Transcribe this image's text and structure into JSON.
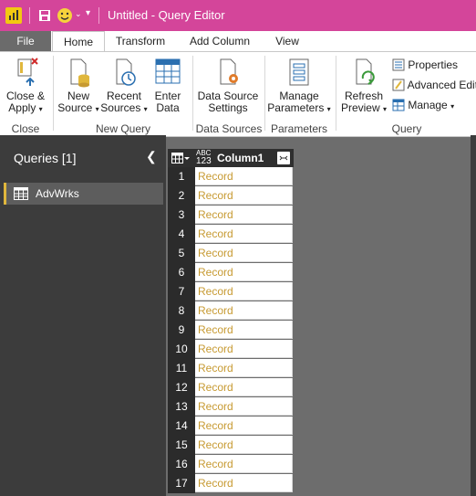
{
  "window": {
    "title": "Untitled - Query Editor"
  },
  "tabs": [
    {
      "label": "File"
    },
    {
      "label": "Home"
    },
    {
      "label": "Transform"
    },
    {
      "label": "Add Column"
    },
    {
      "label": "View"
    }
  ],
  "ribbon": {
    "close_apply": {
      "line1": "Close &",
      "line2": "Apply"
    },
    "new_source": {
      "line1": "New",
      "line2": "Source"
    },
    "recent_sources": {
      "line1": "Recent",
      "line2": "Sources"
    },
    "enter_data": {
      "line1": "Enter",
      "line2": "Data"
    },
    "data_source_settings": {
      "line1": "Data Source",
      "line2": "Settings"
    },
    "manage_parameters": {
      "line1": "Manage",
      "line2": "Parameters"
    },
    "refresh_preview": {
      "line1": "Refresh",
      "line2": "Preview"
    },
    "properties": "Properties",
    "advanced_editor": "Advanced Edit",
    "manage": "Manage",
    "groups": {
      "close": "Close",
      "new_query": "New Query",
      "data_sources": "Data Sources",
      "parameters": "Parameters",
      "query": "Query"
    }
  },
  "queries": {
    "title": "Queries [1]",
    "items": [
      {
        "label": "AdvWrks"
      }
    ]
  },
  "grid": {
    "type_label_top": "ABC",
    "type_label_bottom": "123",
    "column": "Column1",
    "rows": [
      {
        "n": "1",
        "v": "Record"
      },
      {
        "n": "2",
        "v": "Record"
      },
      {
        "n": "3",
        "v": "Record"
      },
      {
        "n": "4",
        "v": "Record"
      },
      {
        "n": "5",
        "v": "Record"
      },
      {
        "n": "6",
        "v": "Record"
      },
      {
        "n": "7",
        "v": "Record"
      },
      {
        "n": "8",
        "v": "Record"
      },
      {
        "n": "9",
        "v": "Record"
      },
      {
        "n": "10",
        "v": "Record"
      },
      {
        "n": "11",
        "v": "Record"
      },
      {
        "n": "12",
        "v": "Record"
      },
      {
        "n": "13",
        "v": "Record"
      },
      {
        "n": "14",
        "v": "Record"
      },
      {
        "n": "15",
        "v": "Record"
      },
      {
        "n": "16",
        "v": "Record"
      },
      {
        "n": "17",
        "v": "Record"
      }
    ]
  },
  "colors": {
    "title_bar": "#d4459a",
    "record_text": "#c79a32",
    "accent": "#e0b73c"
  }
}
